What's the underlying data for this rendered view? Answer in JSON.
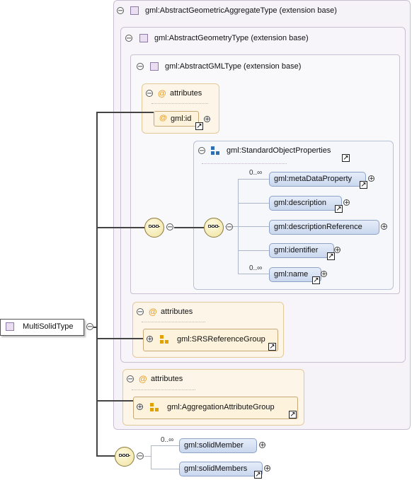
{
  "root": {
    "label": "MultiSolidType"
  },
  "ext1": {
    "label": "gml:AbstractGeometricAggregateType (extension base)"
  },
  "ext2": {
    "label": "gml:AbstractGeometryType (extension base)"
  },
  "ext3": {
    "label": "gml:AbstractGMLType (extension base)"
  },
  "attributes_label": "attributes",
  "attr_id": "gml:id",
  "group": {
    "label": "gml:StandardObjectProperties",
    "elements": [
      {
        "label": "gml:metaDataProperty",
        "mult": "0..∞"
      },
      {
        "label": "gml:description",
        "mult": ""
      },
      {
        "label": "gml:descriptionReference",
        "mult": ""
      },
      {
        "label": "gml:identifier",
        "mult": ""
      },
      {
        "label": "gml:name",
        "mult": "0..∞"
      }
    ]
  },
  "attr_groups": {
    "srs": "gml:SRSReferenceGroup",
    "aggregation": "gml:AggregationAttributeGroup"
  },
  "choice": {
    "elements": [
      {
        "label": "gml:solidMember",
        "mult": "0..∞"
      },
      {
        "label": "gml:solidMembers",
        "mult": ""
      }
    ]
  },
  "colors": {
    "extension_fill": "#f6f3f8",
    "attribute_fill": "#fdf6e8",
    "element_fill": "#c9d7ee",
    "connector": "#444444"
  }
}
